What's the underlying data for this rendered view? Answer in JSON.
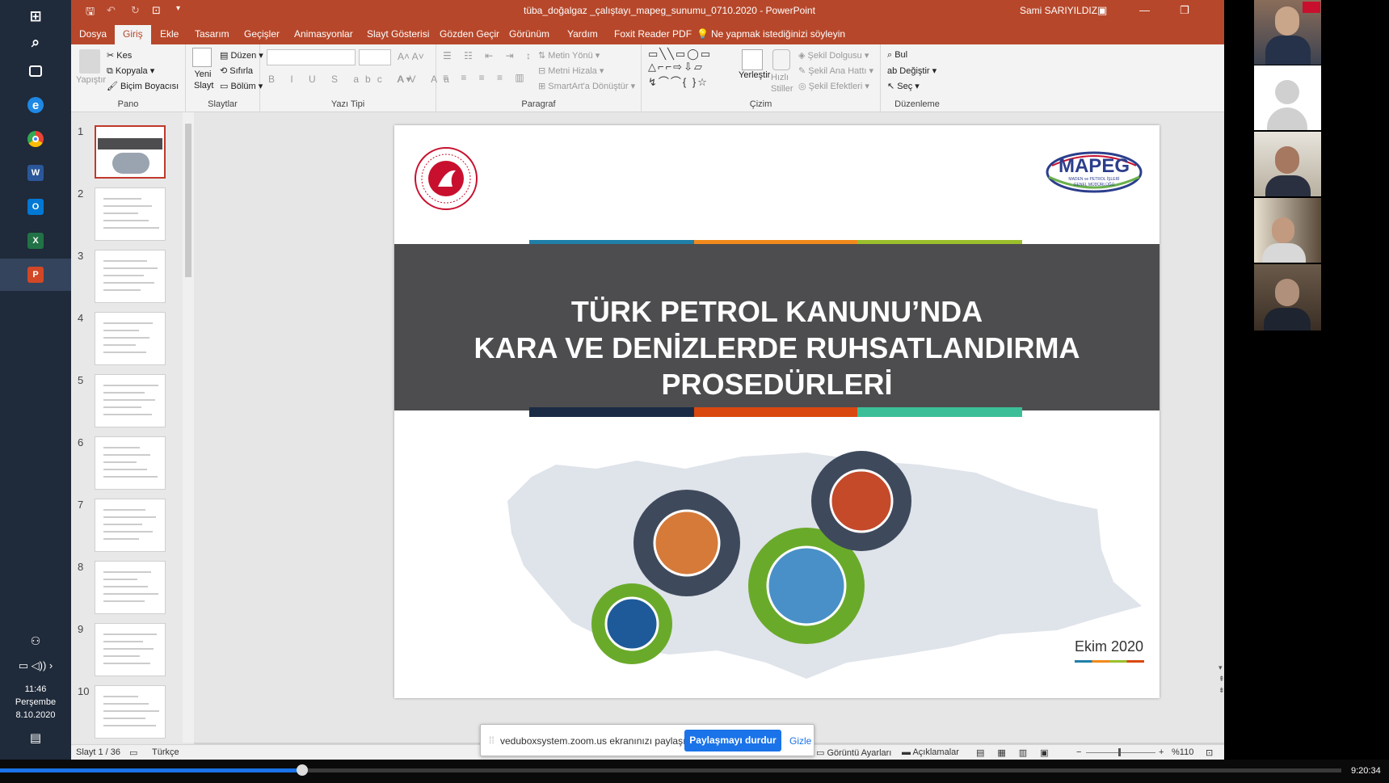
{
  "taskbar": {
    "apps": [
      {
        "name": "windows-start-icon",
        "glyph": "⊞",
        "color": "#1f2a3a"
      },
      {
        "name": "search-icon",
        "glyph": "⌕",
        "color": "#1f2a3a"
      },
      {
        "name": "task-view-icon",
        "glyph": "▭",
        "color": "#1f2a3a"
      },
      {
        "name": "edge-icon",
        "glyph": "e",
        "color": "#1e88e5"
      },
      {
        "name": "chrome-icon",
        "glyph": "◉",
        "color": "#34a853"
      },
      {
        "name": "word-icon",
        "glyph": "W",
        "color": "#2b579a"
      },
      {
        "name": "outlook-icon",
        "glyph": "O",
        "color": "#0078d4"
      },
      {
        "name": "excel-icon",
        "glyph": "X",
        "color": "#217346"
      },
      {
        "name": "powerpoint-icon",
        "glyph": "P",
        "color": "#d24726"
      }
    ],
    "time": "11:46",
    "day": "Perşembe",
    "date": "8.10.2020"
  },
  "window": {
    "title": "tüba_doğalgaz _çalıştayı_mapeg_sunumu_0710.2020  -  PowerPoint",
    "user": "Sami SARIYILDIZ"
  },
  "tabs": [
    "Dosya",
    "Giriş",
    "Ekle",
    "Tasarım",
    "Geçişler",
    "Animasyonlar",
    "Slayt Gösterisi",
    "Gözden Geçir",
    "Görünüm",
    "Yardım",
    "Foxit Reader PDF"
  ],
  "tell_me": "Ne yapmak istediğinizi söyleyin",
  "ribbon": {
    "pano": {
      "label": "Pano",
      "paste": "Yapıştır",
      "cut": "Kes",
      "copy": "Kopyala",
      "format_painter": "Biçim Boyacısı"
    },
    "slaytlar": {
      "label": "Slaytlar",
      "new_slide": "Yeni Slayt",
      "layout": "Düzen",
      "reset": "Sıfırla",
      "section": "Bölüm"
    },
    "yazi_tipi": {
      "label": "Yazı Tipi"
    },
    "paragraf": {
      "label": "Paragraf",
      "text_direction": "Metin Yönü",
      "align_text": "Metni Hizala",
      "smartart": "SmartArt'a Dönüştür"
    },
    "cizim": {
      "label": "Çizim",
      "arrange": "Yerleştir",
      "quick_styles": "Hızlı Stiller",
      "fill": "Şekil Dolgusu",
      "outline": "Şekil Ana Hattı",
      "effects": "Şekil Efektleri"
    },
    "duzenleme": {
      "label": "Düzenleme",
      "find": "Bul",
      "replace": "Değiştir",
      "select": "Seç"
    }
  },
  "thumbnails": [
    "1",
    "2",
    "3",
    "4",
    "5",
    "6",
    "7",
    "8",
    "9",
    "10"
  ],
  "slide": {
    "title_lines": [
      "TÜRK PETROL KANUNU’NDA",
      "KARA VE DENİZLERDE RUHSATLANDIRMA",
      "PROSEDÜRLERİ"
    ],
    "date": "Ekim 2020",
    "logo_text": "MAPEG",
    "logo_sub": "MADEN ve PETROL İŞLERİ",
    "logo_sub2": "GENEL MÜDÜRLÜĞÜ"
  },
  "status": {
    "slide": "Slayt 1 / 36",
    "language": "Türkçe",
    "display_settings": "Görüntü Ayarları",
    "comments": "Açıklamalar",
    "zoom": "%110"
  },
  "share": {
    "message": "veduboxsystem.zoom.us ekranınızı paylaşıyor.",
    "stop": "Paylaşmayı durdur",
    "hide": "Gizle"
  },
  "playback": {
    "time": "9:20:34",
    "progress": 0.225
  },
  "colors": {
    "ppt": "#b7472a",
    "stripe_top": [
      "#1f7fa8",
      "#f18a1c",
      "#9bbf2c"
    ],
    "stripe_bottom": [
      "#1b2b45",
      "#d9480f",
      "#3cbf99"
    ]
  }
}
